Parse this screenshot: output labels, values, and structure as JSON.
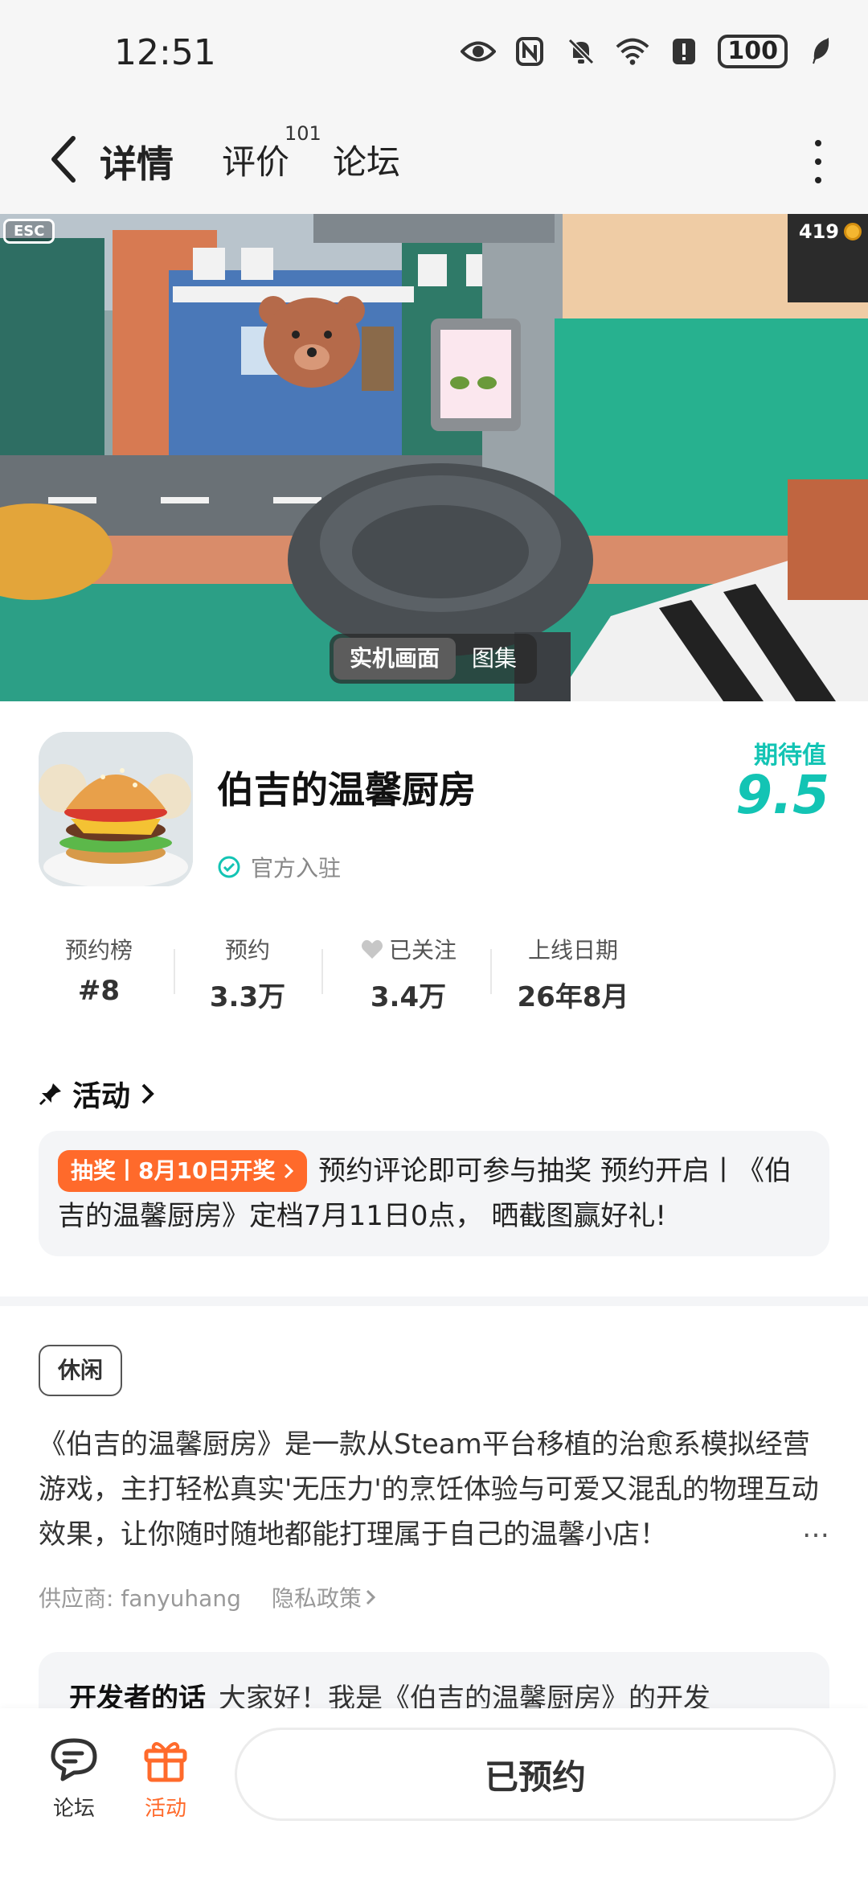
{
  "status_bar": {
    "time": "12:51",
    "battery": "100",
    "icons": [
      "eye-icon",
      "nfc-icon",
      "mute-icon",
      "wifi-icon",
      "alert-icon",
      "battery-icon",
      "leaf-icon"
    ]
  },
  "nav": {
    "tabs": [
      {
        "label": "详情",
        "active": true
      },
      {
        "label": "评价",
        "count": "101"
      },
      {
        "label": "论坛"
      }
    ]
  },
  "hero": {
    "esc_label": "ESC",
    "coin_count": "419",
    "media_options": [
      "实机画面",
      "图集"
    ],
    "active_media": "实机画面"
  },
  "game": {
    "title": "伯吉的温馨厨房",
    "official_label": "官方入驻",
    "expect_label": "期待值",
    "expect_value": "9.5",
    "accent_color": "#13c4b4"
  },
  "stats": [
    {
      "label": "预约榜",
      "value": "#8"
    },
    {
      "label": "预约",
      "value": "3.3万"
    },
    {
      "label": "已关注",
      "value": "3.4万"
    },
    {
      "label": "上线日期",
      "value": "26年8月"
    }
  ],
  "activity": {
    "header": "活动",
    "badge": "抽奖丨8月10日开奖",
    "text": "预约评论即可参与抽奖 预约开启丨《伯吉的温馨厨房》定档7月11日0点， 晒截图赢好礼!",
    "badge_color": "#ff6a2b"
  },
  "info": {
    "tag": "休闲",
    "description": "《伯吉的温馨厨房》是一款从Steam平台移植的治愈系模拟经营游戏，主打轻松真实'无压力'的烹饪体验与可爱又混乱的物理互动效果，让你随时随地都能打理属于自己的温馨小店！",
    "more": "…",
    "supplier": "供应商: fanyuhang",
    "privacy": "隐私政策"
  },
  "developer": {
    "label": "开发者的话",
    "text": "大家好！我是《伯吉的温馨厨房》的开发"
  },
  "bottom_bar": {
    "forum_label": "论坛",
    "activity_label": "活动",
    "reserve_label": "已预约"
  }
}
